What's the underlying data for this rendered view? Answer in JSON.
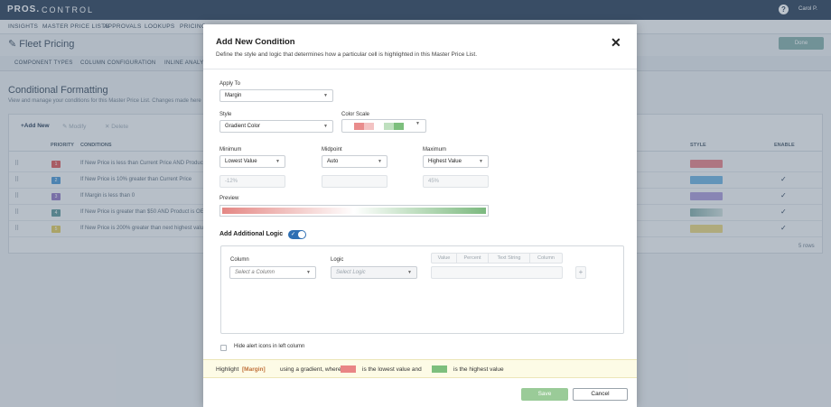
{
  "app": {
    "brand": "PROS.",
    "product": "CONTROL",
    "user": "Carol P."
  },
  "nav": [
    "INSIGHTS",
    "MASTER PRICE LISTS",
    "APPROVALS",
    "LOOKUPS",
    "PRICING"
  ],
  "page": {
    "title": "Fleet Pricing",
    "done_label": "Done"
  },
  "subtabs": [
    "COMPONENT TYPES",
    "COLUMN CONFIGURATION",
    "INLINE ANALY"
  ],
  "section": {
    "title": "Conditional Formatting",
    "description": "View and manage your conditions for this Master Price List. Changes made here"
  },
  "table": {
    "toolbar": {
      "add": "Add New",
      "modify": "Modify",
      "delete": "Delete"
    },
    "headers": {
      "priority": "PRIORITY",
      "conditions": "CONDITIONS",
      "style": "STYLE",
      "enable": "ENABLE"
    },
    "rows": [
      {
        "priority": "1",
        "priority_color": "#e06666",
        "condition": "If New Price is less than Current Price AND Product",
        "style_color": "#e98c92",
        "enabled": false
      },
      {
        "priority": "2",
        "priority_color": "#5aa0d8",
        "condition": "If New Price is 10% greater than Current Price",
        "style_color": "#7ab8e3",
        "enabled": true
      },
      {
        "priority": "3",
        "priority_color": "#9b84c9",
        "condition": "If Margin is less than 0",
        "style_color": "#b2a2dc",
        "enabled": true
      },
      {
        "priority": "4",
        "priority_color": "#6a9fa3",
        "condition": "If New Price is greater than $50 AND Product is OE",
        "style_color": "#8db3b0",
        "enabled": true
      },
      {
        "priority": "5",
        "priority_color": "#e3cf6a",
        "condition": "If New Price is 200% greater than next highest valu",
        "style_color": "#ead98a",
        "enabled": true
      }
    ],
    "count": "5 rows"
  },
  "modal": {
    "title": "Add New Condition",
    "subtitle": "Define the style and logic that determines how a particular cell is highlighted in this Master Price List.",
    "apply_to": {
      "label": "Apply To",
      "value": "Margin"
    },
    "style": {
      "label": "Style",
      "value": "Gradient Color"
    },
    "color_scale": {
      "label": "Color Scale",
      "colors": [
        "#e98c8c",
        "#f3c3c3",
        "#ffffff",
        "#bfe0bf",
        "#7dbf7d"
      ]
    },
    "minimum": {
      "label": "Minimum",
      "value": "Lowest Value",
      "placeholder": "-12%"
    },
    "midpoint": {
      "label": "Midpoint",
      "value": "Auto",
      "placeholder": ""
    },
    "maximum": {
      "label": "Maximum",
      "value": "Highest Value",
      "placeholder": "45%"
    },
    "preview_label": "Preview",
    "additional_logic": {
      "label": "Add Additional Logic",
      "enabled": true,
      "column_label": "Column",
      "column_placeholder": "Select a Column",
      "logic_label": "Logic",
      "logic_placeholder": "Select Logic",
      "value_types": [
        "Value",
        "Percent",
        "Text String",
        "Column"
      ],
      "add_symbol": "+"
    },
    "hide_alert_icons": {
      "label": "Hide alert icons in left column",
      "checked": false
    },
    "summary": {
      "prefix": "Highlight",
      "field": "[Margin]",
      "middle": "using a gradient, where",
      "low_color": "#e98585",
      "low_text": "is the lowest value and",
      "high_color": "#7dbf7d",
      "high_text": "is the highest value"
    },
    "save_label": "Save",
    "cancel_label": "Cancel"
  }
}
